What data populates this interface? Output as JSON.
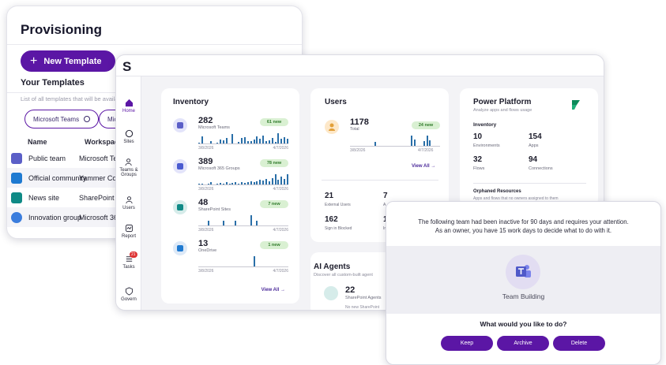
{
  "provisioning": {
    "title": "Provisioning",
    "new_template_label": "New Template",
    "your_templates": "Your Templates",
    "description": "List of all templates that will be availa",
    "chips": [
      "Microsoft Teams",
      "Mic"
    ],
    "columns": [
      "Name",
      "Workspace"
    ],
    "rows": [
      {
        "name": "Public team",
        "workspace": "Microsoft Te"
      },
      {
        "name": "Official community",
        "workspace": "Yammer Co"
      },
      {
        "name": "News site",
        "workspace": "SharePoint S"
      },
      {
        "name": "Innovation group",
        "workspace": "Microsoft 36"
      }
    ]
  },
  "app": {
    "logo": "S",
    "nav": [
      {
        "label": "Home",
        "icon": "home-icon"
      },
      {
        "label": "Sites",
        "icon": "sites-icon"
      },
      {
        "label": "Teams & Groups",
        "icon": "teams-groups-icon"
      },
      {
        "label": "Users",
        "icon": "users-icon"
      },
      {
        "label": "Report",
        "icon": "report-icon"
      },
      {
        "label": "Tasks",
        "icon": "tasks-icon",
        "badge": "21"
      },
      {
        "label": "Govern",
        "icon": "govern-icon"
      }
    ]
  },
  "inventory": {
    "title": "Inventory",
    "items": [
      {
        "count": "282",
        "label": "Microsoft Teams",
        "new": "61 new",
        "start": "3/8/2026",
        "end": "4/7/2026",
        "bars": [
          0.1,
          0.65,
          0,
          0,
          0.2,
          0,
          0.1,
          0.35,
          0.3,
          0.5,
          0,
          0.85,
          0,
          0.15,
          0.5,
          0.6,
          0.2,
          0.25,
          0.35,
          0.65,
          0.4,
          0.75,
          0.2,
          0.3,
          0.5,
          0.15,
          0.95,
          0.4,
          0.55,
          0.45
        ]
      },
      {
        "count": "389",
        "label": "Microsoft 365 Groups",
        "new": "78 new",
        "start": "3/8/2026",
        "end": "4/7/2026",
        "bars": [
          0.1,
          0.1,
          0,
          0.1,
          0.2,
          0,
          0.1,
          0.15,
          0.1,
          0.2,
          0.1,
          0.15,
          0.2,
          0.1,
          0.2,
          0.15,
          0.2,
          0.3,
          0.25,
          0.3,
          0.4,
          0.35,
          0.5,
          0.3,
          0.6,
          0.9,
          0.4,
          0.7,
          0.5,
          0.95
        ]
      },
      {
        "count": "48",
        "label": "SharePoint Sites",
        "new": "7 new",
        "start": "3/8/2026",
        "end": "4/7/2026",
        "bars": [
          0,
          0,
          0,
          0.45,
          0,
          0,
          0,
          0,
          0.45,
          0,
          0,
          0,
          0.45,
          0,
          0,
          0,
          0,
          0.9,
          0,
          0.45,
          0,
          0,
          0,
          0,
          0,
          0,
          0,
          0,
          0,
          0
        ]
      },
      {
        "count": "13",
        "label": "OneDrive",
        "new": "1 new",
        "start": "3/8/2026",
        "end": "4/7/2026",
        "bars": [
          0,
          0,
          0,
          0,
          0,
          0,
          0,
          0,
          0,
          0,
          0,
          0,
          0,
          0,
          0,
          0,
          0,
          0,
          0.95,
          0,
          0,
          0,
          0,
          0,
          0,
          0,
          0,
          0,
          0,
          0
        ]
      }
    ],
    "view_all": "View All →"
  },
  "users": {
    "title": "Users",
    "count": "1178",
    "count_label": "Total",
    "new": "24 new",
    "start": "3/8/2026",
    "end": "4/7/2026",
    "bars": [
      0,
      0,
      0,
      0,
      0,
      0,
      0,
      0,
      0.35,
      0,
      0,
      0,
      0,
      0,
      0,
      0,
      0,
      0,
      0,
      0,
      0.9,
      0.55,
      0,
      0,
      0.4,
      0.9,
      0.5,
      0,
      0,
      0
    ],
    "view_all": "View All →",
    "stats": [
      {
        "value": "21",
        "label": "External Users"
      },
      {
        "value": "7",
        "label": "A"
      },
      {
        "value": "162",
        "label": "Sign in Blocked"
      },
      {
        "value": "1",
        "label": "In"
      }
    ]
  },
  "ai_agents": {
    "title": "AI Agents",
    "subtitle": "Discover all custom-built agent",
    "count": "22",
    "count_label": "SharePoint Agents",
    "note": "No new SharePoint"
  },
  "power_platform": {
    "title": "Power Platform",
    "subtitle": "Analyze apps and flows usage",
    "inventory_label": "Inventory",
    "stats": [
      {
        "value": "10",
        "label": "Environments"
      },
      {
        "value": "154",
        "label": "Apps"
      },
      {
        "value": "32",
        "label": "Flows"
      },
      {
        "value": "94",
        "label": "Connections"
      }
    ],
    "orphaned_title": "Orphaned Resources",
    "orphaned_sub": "Apps and flows that no owners assigned to them"
  },
  "dialog": {
    "message_line1": "The following team had been inactive for 90 days and requires your attention.",
    "message_line2": "As an owner, you have 15 work days to decide what to do with it.",
    "team_name": "Team Building",
    "question": "What would you like to do?",
    "buttons": [
      "Keep",
      "Archive",
      "Delete"
    ]
  },
  "colors": {
    "brand": "#5b16a5",
    "teams": "#5b5fc7",
    "new_badge_bg": "#d9f0d2",
    "chart_bar": "#2a6fa8"
  }
}
